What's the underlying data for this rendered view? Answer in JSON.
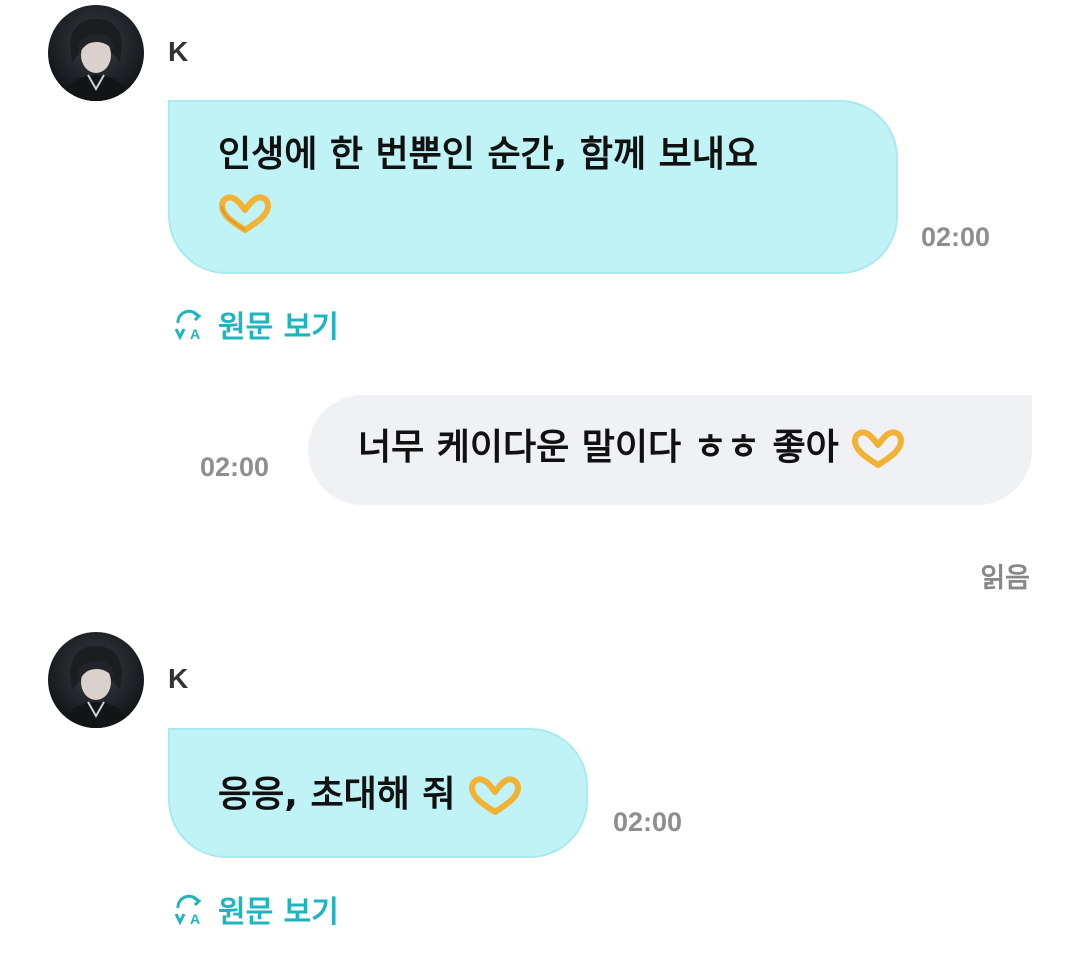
{
  "messages": [
    {
      "sender": "K",
      "line1": "인생에 한 번뿐인 순간, 함께 보내요",
      "emoji": "heart-hands-emoji",
      "time": "02:00",
      "translate_label": "원문 보기"
    },
    {
      "text": "너무 케이다운 말이다 ㅎㅎ 좋아",
      "emoji": "heart-hands-emoji",
      "time": "02:00",
      "read_label": "읽음"
    },
    {
      "sender": "K",
      "text": "응응, 초대해 줘",
      "emoji": "heart-hands-emoji",
      "time": "02:00",
      "translate_label": "원문 보기"
    }
  ],
  "colors": {
    "incoming_bubble": "#bff3f6",
    "outgoing_bubble": "#f0f1f5",
    "accent": "#1fb4bf",
    "timestamp": "#8e8e8e"
  }
}
